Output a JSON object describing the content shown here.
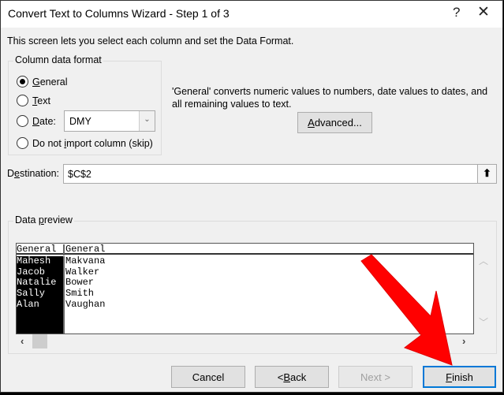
{
  "window": {
    "title": "Convert Text to Columns Wizard - Step 1 of 3",
    "help_icon": "question-mark",
    "close_icon": "x"
  },
  "description": "This screen lets you select each column and set the Data Format.",
  "column_format": {
    "label": "Column data format",
    "options": [
      {
        "pre": "",
        "key": "G",
        "post": "eneral",
        "selected": true
      },
      {
        "pre": "",
        "key": "T",
        "post": "ext",
        "selected": false
      },
      {
        "pre": "",
        "key": "D",
        "post": "ate:",
        "selected": false
      },
      {
        "pre": "Do not ",
        "key": "i",
        "post": "mport column (skip)",
        "selected": false
      }
    ],
    "date_value": "DMY"
  },
  "info_text": "'General' converts numeric values to numbers, date values to dates, and all remaining values to text.",
  "advanced": {
    "key": "A",
    "rest": "dvanced..."
  },
  "destination": {
    "label_pre": "D",
    "label_key": "e",
    "label_post": "stination:",
    "value": "$C$2"
  },
  "preview": {
    "label_pre": "Data ",
    "label_key": "p",
    "label_post": "review",
    "headers": [
      "General",
      "General"
    ],
    "col1": [
      "Mahesh",
      "Jacob",
      "Natalie",
      "Sally",
      "Alan"
    ],
    "col2": [
      "Makvana",
      "Walker",
      "Bower",
      "Smith",
      "Vaughan"
    ]
  },
  "buttons": {
    "cancel": "Cancel",
    "back_pre": "< ",
    "back_key": "B",
    "back_post": "ack",
    "next": "Next >",
    "finish_key": "F",
    "finish_post": "inish"
  },
  "colors": {
    "accent": "#0078d7",
    "arrow": "#ff0000"
  }
}
